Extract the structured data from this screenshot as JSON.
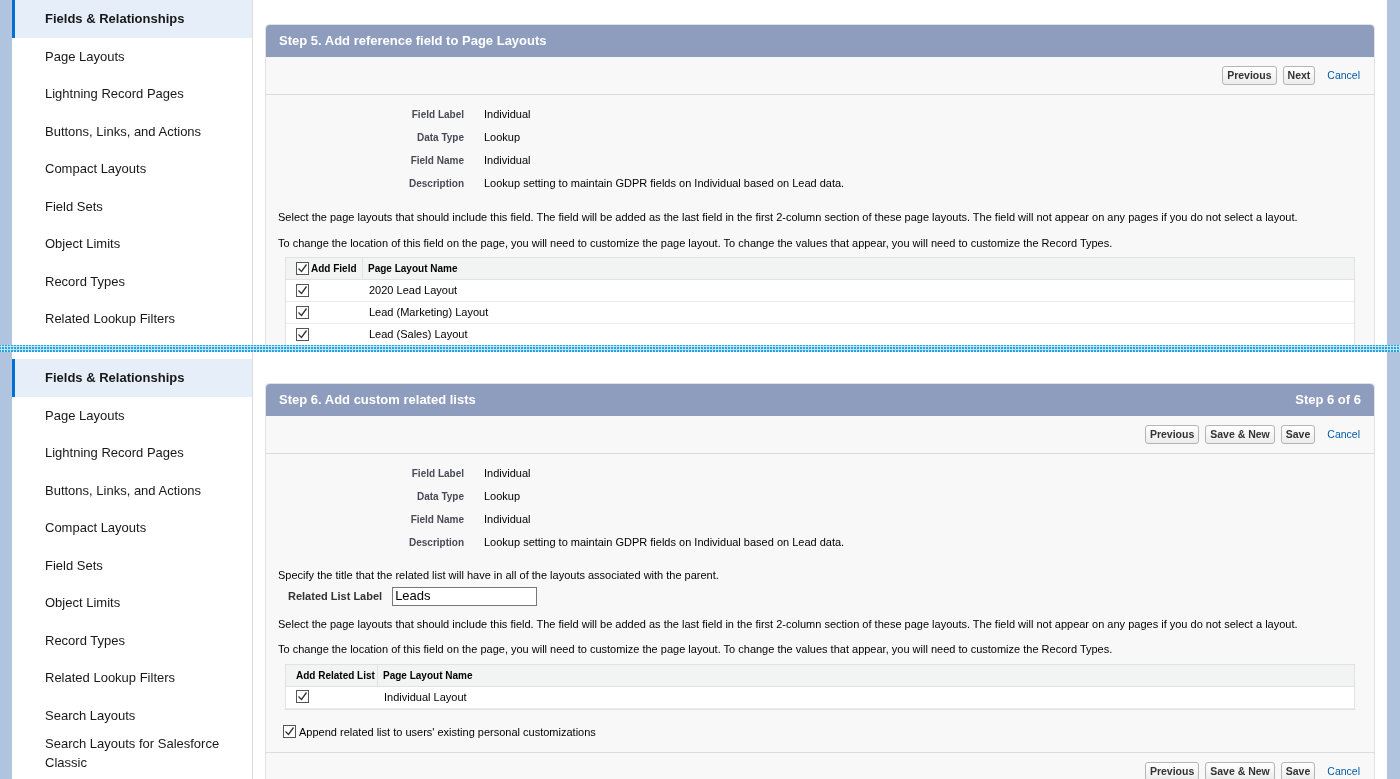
{
  "sections": [
    {
      "sidebar": {
        "items": [
          {
            "label": "Fields & Relationships",
            "selected": true
          },
          {
            "label": "Page Layouts",
            "selected": false
          },
          {
            "label": "Lightning Record Pages",
            "selected": false
          },
          {
            "label": "Buttons, Links, and Actions",
            "selected": false
          },
          {
            "label": "Compact Layouts",
            "selected": false
          },
          {
            "label": "Field Sets",
            "selected": false
          },
          {
            "label": "Object Limits",
            "selected": false
          },
          {
            "label": "Record Types",
            "selected": false
          },
          {
            "label": "Related Lookup Filters",
            "selected": false
          }
        ]
      },
      "panel": {
        "title": "Step 5. Add reference field to Page Layouts",
        "buttons": [
          {
            "kind": "button",
            "label": "Previous"
          },
          {
            "kind": "button",
            "label": "Next"
          },
          {
            "kind": "link",
            "label": "Cancel"
          }
        ],
        "details": [
          {
            "label": "Field Label",
            "value": "Individual"
          },
          {
            "label": "Data Type",
            "value": "Lookup"
          },
          {
            "label": "Field Name",
            "value": "Individual"
          },
          {
            "label": "Description",
            "value": "Lookup setting to maintain GDPR fields on Individual based on Lead data."
          }
        ],
        "instructions": [
          "Select the page layouts that should include this field. The field will be added as the last field in the first 2-column section of these page layouts. The field will not appear on any pages if you do not select a layout.",
          "To change the location of this field on the page, you will need to customize the page layout. To change the values that appear, you will need to customize the Record Types."
        ],
        "table": {
          "header_checkbox": {
            "checked": true
          },
          "columns": [
            "Add Field",
            "Page Layout Name"
          ],
          "rows": [
            {
              "checked": true,
              "name": "2020 Lead Layout"
            },
            {
              "checked": true,
              "name": "Lead (Marketing) Layout"
            },
            {
              "checked": true,
              "name": "Lead (Sales) Layout"
            }
          ]
        }
      }
    },
    {
      "sidebar": {
        "items": [
          {
            "label": "Fields & Relationships",
            "selected": true
          },
          {
            "label": "Page Layouts",
            "selected": false
          },
          {
            "label": "Lightning Record Pages",
            "selected": false
          },
          {
            "label": "Buttons, Links, and Actions",
            "selected": false
          },
          {
            "label": "Compact Layouts",
            "selected": false
          },
          {
            "label": "Field Sets",
            "selected": false
          },
          {
            "label": "Object Limits",
            "selected": false
          },
          {
            "label": "Record Types",
            "selected": false
          },
          {
            "label": "Related Lookup Filters",
            "selected": false
          },
          {
            "label": "Search Layouts",
            "selected": false
          },
          {
            "label": "Search Layouts for Salesforce Classic",
            "selected": false
          }
        ]
      },
      "panel": {
        "title": "Step 6. Add custom related lists",
        "step_label": "Step 6 of 6",
        "buttons": [
          {
            "kind": "button",
            "label": "Previous"
          },
          {
            "kind": "button",
            "label": "Save & New"
          },
          {
            "kind": "button",
            "label": "Save"
          },
          {
            "kind": "link",
            "label": "Cancel"
          }
        ],
        "details": [
          {
            "label": "Field Label",
            "value": "Individual"
          },
          {
            "label": "Data Type",
            "value": "Lookup"
          },
          {
            "label": "Field Name",
            "value": "Individual"
          },
          {
            "label": "Description",
            "value": "Lookup setting to maintain GDPR fields on Individual based on Lead data."
          }
        ],
        "related_list": {
          "intro": "Specify the title that the related list will have in all of the layouts associated with the parent.",
          "label": "Related List Label",
          "value": "Leads"
        },
        "instructions": [
          "Select the page layouts that should include this field. The field will be added as the last field in the first 2-column section of these page layouts. The field will not appear on any pages if you do not select a layout.",
          "To change the location of this field on the page, you will need to customize the page layout. To change the values that appear, you will need to customize the Record Types."
        ],
        "table": {
          "columns": [
            "Add Related List",
            "Page Layout Name"
          ],
          "rows": [
            {
              "checked": true,
              "name": "Individual Layout"
            }
          ]
        },
        "append_option": {
          "checked": true,
          "label": "Append related list to users' existing personal customizations"
        },
        "bottom_buttons": [
          {
            "kind": "button",
            "label": "Previous"
          },
          {
            "kind": "button",
            "label": "Save & New"
          },
          {
            "kind": "button",
            "label": "Save"
          },
          {
            "kind": "link",
            "label": "Cancel"
          }
        ]
      }
    }
  ]
}
